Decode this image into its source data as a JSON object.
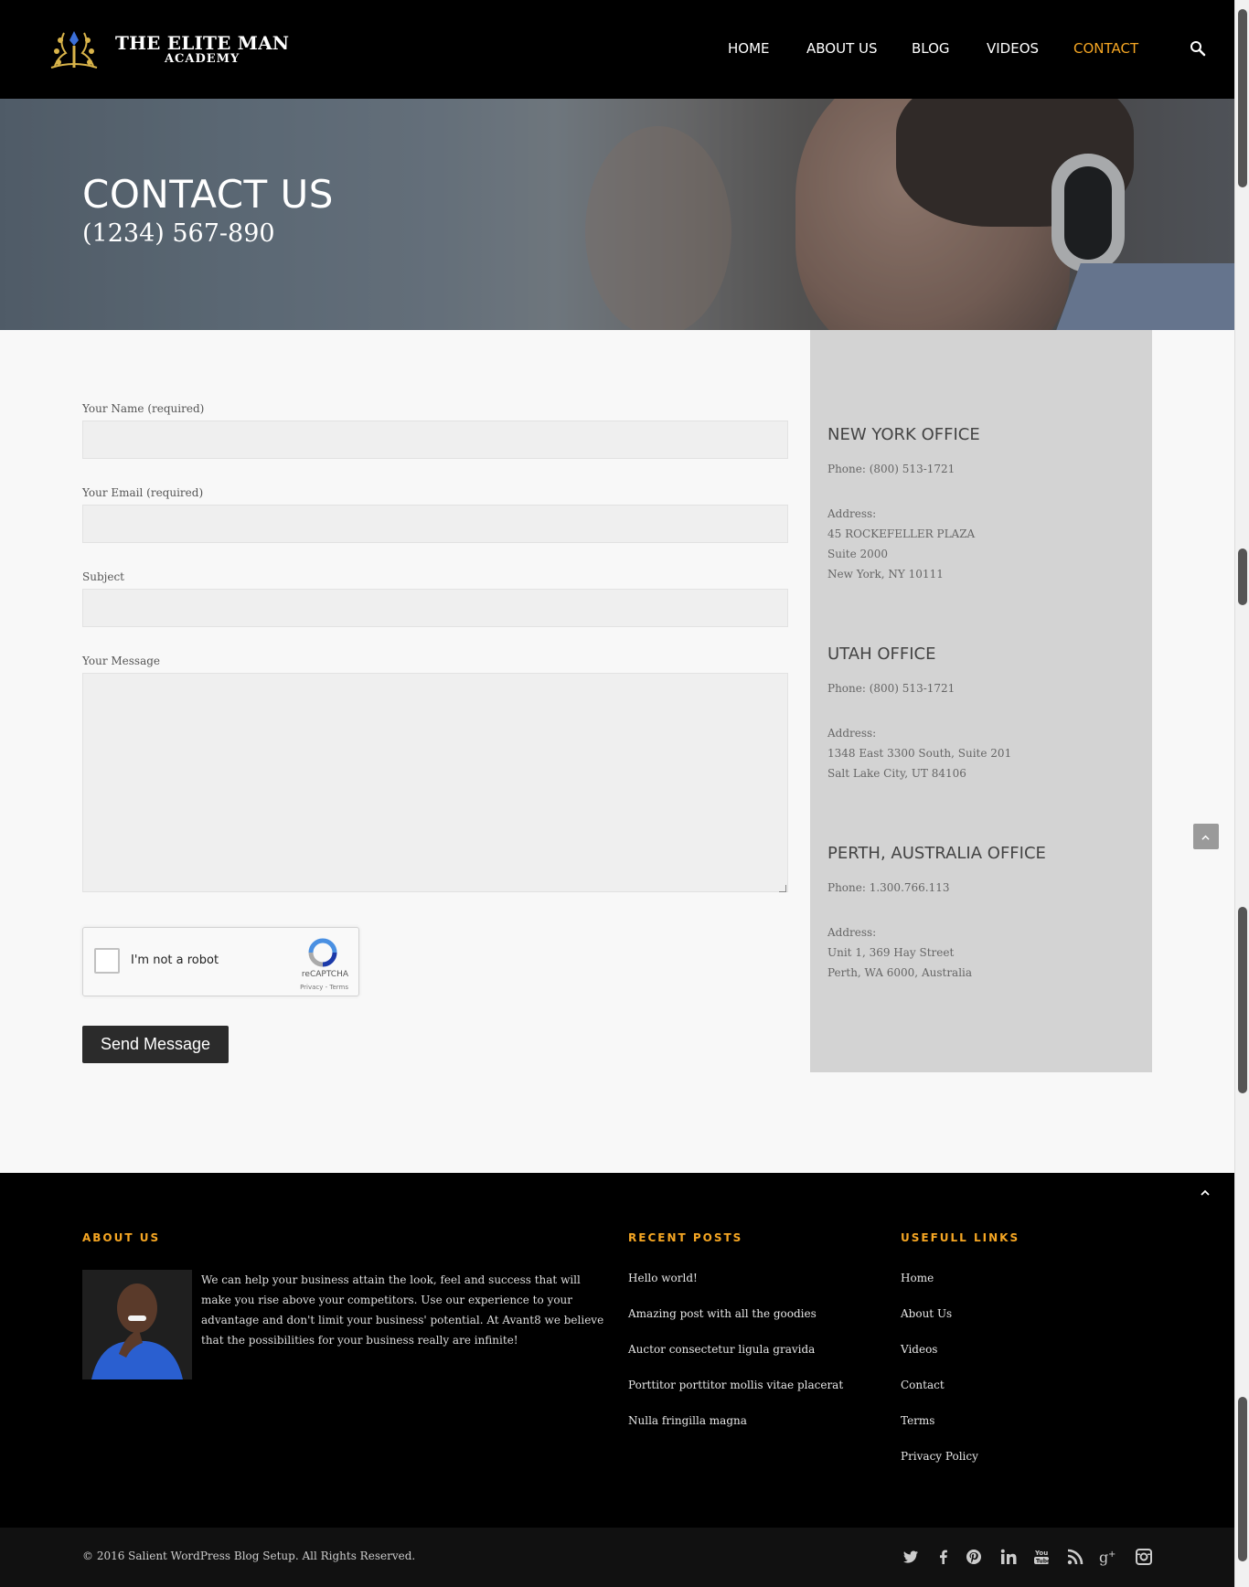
{
  "brand": {
    "line1": "THE ELITE MAN",
    "line2": "ACADEMY"
  },
  "nav": {
    "items": [
      {
        "label": "HOME"
      },
      {
        "label": "ABOUT US"
      },
      {
        "label": "BLOG"
      },
      {
        "label": "VIDEOS"
      },
      {
        "label": "CONTACT",
        "active": true
      }
    ],
    "search_icon": "search-icon"
  },
  "hero": {
    "title": "CONTACT US",
    "phone": "(1234) 567-890"
  },
  "form": {
    "name_label": "Your Name (required)",
    "name_value": "",
    "email_label": "Your Email (required)",
    "email_value": "",
    "subject_label": "Subject",
    "subject_value": "",
    "message_label": "Your Message",
    "message_value": "",
    "captcha_label": "I'm not a robot",
    "captcha_brand": "reCAPTCHA",
    "captcha_links": "Privacy - Terms",
    "send_label": "Send Message"
  },
  "offices": [
    {
      "title": "NEW YORK OFFICE",
      "phone": "Phone: (800) 513-1721",
      "address_label": "Address:",
      "address_lines": [
        "45 ROCKEFELLER PLAZA",
        "Suite 2000",
        "New York, NY 10111"
      ]
    },
    {
      "title": "UTAH OFFICE",
      "phone": "Phone: (800) 513-1721",
      "address_label": "Address:",
      "address_lines": [
        "1348 East 3300 South, Suite 201",
        "Salt Lake City, UT 84106"
      ]
    },
    {
      "title": "PERTH, AUSTRALIA OFFICE",
      "phone": "Phone: 1.300.766.113",
      "address_label": "Address:",
      "address_lines": [
        "Unit 1, 369 Hay Street",
        "Perth, WA 6000, Australia"
      ]
    }
  ],
  "footer": {
    "about_title": "ABOUT US",
    "about_text": "We can help your business attain the look, feel and success that will make you rise above your competitors. Use our experience to your advantage and don't limit your business' potential. At Avant8 we believe that the possibilities for your business really are infinite!",
    "recent_title": "RECENT POSTS",
    "recent_posts": [
      "Hello world!",
      "Amazing post with all the goodies",
      "Auctor consectetur ligula gravida",
      "Porttitor porttitor mollis vitae placerat",
      "Nulla fringilla magna"
    ],
    "links_title": "USEFULL LINKS",
    "links": [
      "Home",
      "About Us",
      "Videos",
      "Contact",
      "Terms",
      "Privacy Policy"
    ],
    "copyright": "© 2016 Salient WordPress Blog Setup. All Rights Reserved.",
    "social_icons": [
      "twitter-icon",
      "facebook-icon",
      "pinterest-icon",
      "linkedin-icon",
      "youtube-icon",
      "rss-icon",
      "google-plus-icon",
      "instagram-icon"
    ]
  },
  "colors": {
    "accent": "#f5a623",
    "header_bg": "#000000",
    "panel_bg": "#d3d3d3",
    "button_bg": "#2b2b2b"
  }
}
